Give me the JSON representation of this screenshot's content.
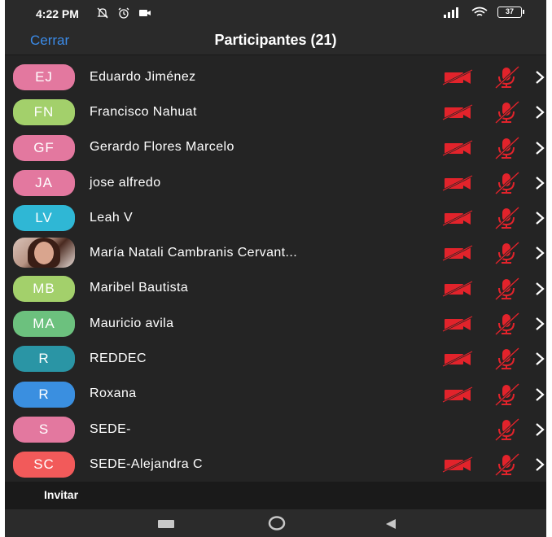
{
  "status_bar": {
    "time": "4:22 PM",
    "battery": "37"
  },
  "header": {
    "close_label": "Cerrar",
    "title": "Participantes (21)"
  },
  "participants": [
    {
      "initials": "EJ",
      "name": "Eduardo Jiménez",
      "avatar_color": "#e3789f",
      "video_off": true,
      "mic_off": true
    },
    {
      "initials": "FN",
      "name": "Francisco Nahuat",
      "avatar_color": "#a3d06b",
      "video_off": true,
      "mic_off": true
    },
    {
      "initials": "GF",
      "name": "Gerardo Flores Marcelo",
      "avatar_color": "#e3789f",
      "video_off": true,
      "mic_off": true
    },
    {
      "initials": "JA",
      "name": "jose alfredo",
      "avatar_color": "#e3789f",
      "video_off": true,
      "mic_off": true
    },
    {
      "initials": "LV",
      "name": "Leah V",
      "avatar_color": "#2fb7d5",
      "video_off": true,
      "mic_off": true
    },
    {
      "initials": "",
      "name": "María Natali Cambranis Cervant...",
      "avatar_color": "photo",
      "video_off": true,
      "mic_off": true
    },
    {
      "initials": "MB",
      "name": "Maribel Bautista",
      "avatar_color": "#a3d06b",
      "video_off": true,
      "mic_off": true
    },
    {
      "initials": "MA",
      "name": "Mauricio avila",
      "avatar_color": "#6cc17e",
      "video_off": true,
      "mic_off": true
    },
    {
      "initials": "R",
      "name": "REDDEC",
      "avatar_color": "#2a95a5",
      "video_off": true,
      "mic_off": true
    },
    {
      "initials": "R",
      "name": "Roxana",
      "avatar_color": "#3a8fe0",
      "video_off": true,
      "mic_off": true
    },
    {
      "initials": "S",
      "name": "SEDE-",
      "avatar_color": "#e3789f",
      "video_off": false,
      "mic_off": true
    },
    {
      "initials": "SC",
      "name": "SEDE-Alejandra C",
      "avatar_color": "#f25a5a",
      "video_off": true,
      "mic_off": true
    }
  ],
  "footer": {
    "invite_label": "Invitar"
  },
  "colors": {
    "accent": "#3b8be8",
    "muted_red": "#e2232b",
    "background": "#242424"
  },
  "icons": {
    "video": "video-off-icon",
    "mic": "mic-off-icon",
    "chevron": "chevron-right-icon"
  }
}
